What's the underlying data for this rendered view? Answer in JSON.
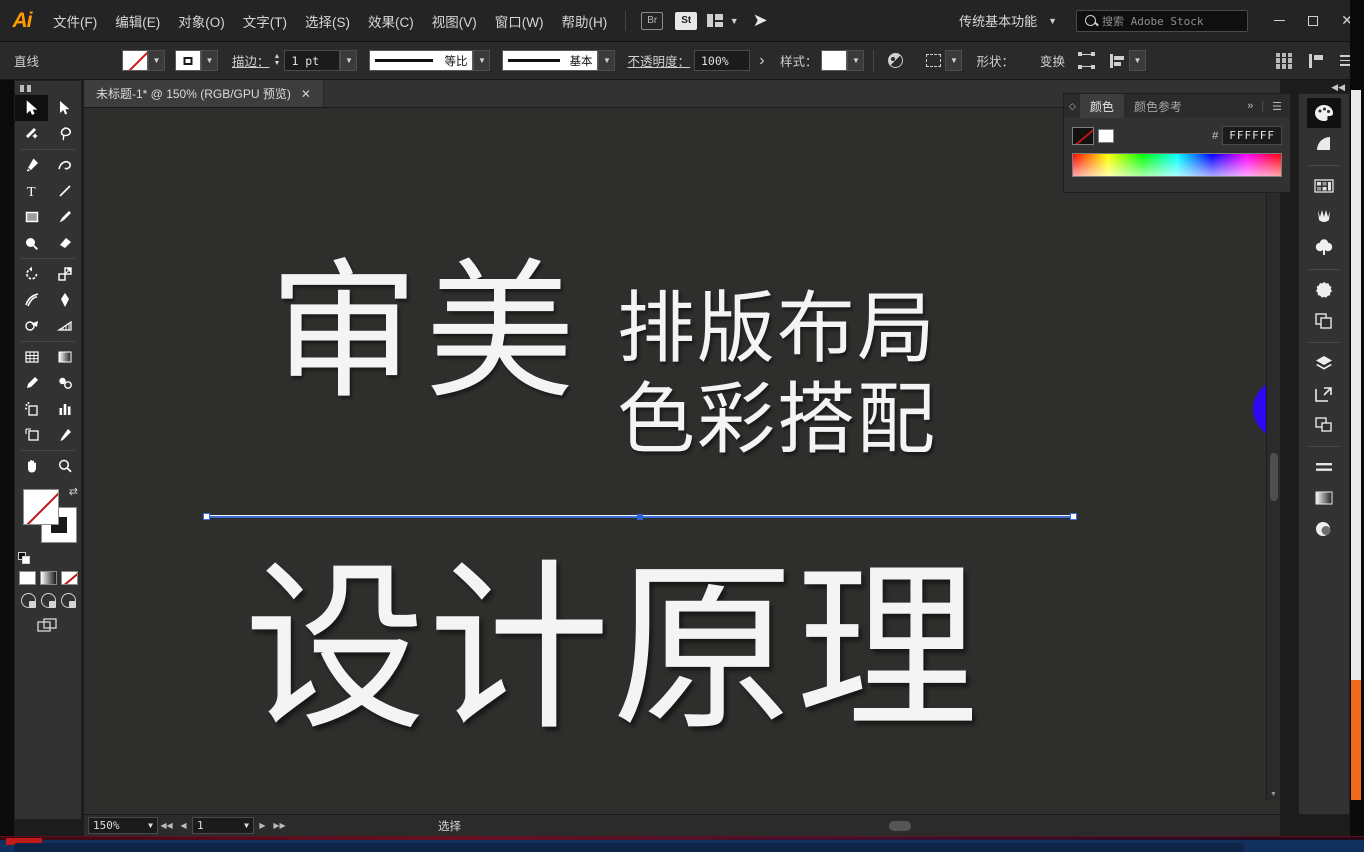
{
  "app": {
    "name": "Adobe Illustrator",
    "logo": "Ai"
  },
  "menubar": {
    "items": [
      {
        "label": "文件(F)",
        "name": "menu-file"
      },
      {
        "label": "编辑(E)",
        "name": "menu-edit"
      },
      {
        "label": "对象(O)",
        "name": "menu-object"
      },
      {
        "label": "文字(T)",
        "name": "menu-type"
      },
      {
        "label": "选择(S)",
        "name": "menu-select"
      },
      {
        "label": "效果(C)",
        "name": "menu-effect"
      },
      {
        "label": "视图(V)",
        "name": "menu-view"
      },
      {
        "label": "窗口(W)",
        "name": "menu-window"
      },
      {
        "label": "帮助(H)",
        "name": "menu-help"
      }
    ],
    "bridge_label": "Br",
    "stock_label": "St",
    "workspace": "传统基本功能",
    "search_placeholder": "搜索 Adobe Stock"
  },
  "controlbar": {
    "object_label": "直线",
    "stroke_label": "描边：",
    "stroke_weight": "1 pt",
    "profile_label": "等比",
    "brush_label": "基本",
    "opacity_label": "不透明度：",
    "opacity_value": "100%",
    "style_label": "样式：",
    "shape_label": "形状：",
    "transform_label": "变换"
  },
  "document_tab": {
    "title": "未标题-1* @ 150% (RGB/GPU 预览)",
    "close": "✕"
  },
  "toolbar": {
    "tools": [
      {
        "name": "selection-tool",
        "label": "选择工具",
        "active": true
      },
      {
        "name": "direct-selection-tool",
        "label": "直接选择工具",
        "active": false
      },
      {
        "name": "magic-wand-tool",
        "label": "魔棒工具",
        "active": false
      },
      {
        "name": "lasso-tool",
        "label": "套索工具",
        "active": false
      },
      {
        "name": "pen-tool",
        "label": "钢笔工具",
        "active": false
      },
      {
        "name": "curvature-tool",
        "label": "曲率工具",
        "active": false
      },
      {
        "name": "type-tool",
        "label": "文字工具",
        "active": false
      },
      {
        "name": "line-segment-tool",
        "label": "直线段工具",
        "active": false
      },
      {
        "name": "rectangle-tool",
        "label": "矩形工具",
        "active": false
      },
      {
        "name": "paintbrush-tool",
        "label": "画笔工具",
        "active": false
      },
      {
        "name": "shaper-tool",
        "label": "Shaper 工具",
        "active": false
      },
      {
        "name": "eraser-tool",
        "label": "橡皮擦工具",
        "active": false
      },
      {
        "name": "rotate-tool",
        "label": "旋转工具",
        "active": false
      },
      {
        "name": "scale-tool",
        "label": "比例缩放工具",
        "active": false
      },
      {
        "name": "width-tool",
        "label": "宽度工具",
        "active": false
      },
      {
        "name": "free-transform-tool",
        "label": "自由变换工具",
        "active": false
      },
      {
        "name": "shape-builder-tool",
        "label": "形状生成器工具",
        "active": false
      },
      {
        "name": "perspective-grid-tool",
        "label": "透视网格工具",
        "active": false
      },
      {
        "name": "mesh-tool",
        "label": "网格工具",
        "active": false
      },
      {
        "name": "gradient-tool",
        "label": "渐变工具",
        "active": false
      },
      {
        "name": "eyedropper-tool",
        "label": "吸管工具",
        "active": false
      },
      {
        "name": "blend-tool",
        "label": "混合工具",
        "active": false
      },
      {
        "name": "symbol-sprayer-tool",
        "label": "符号喷枪工具",
        "active": false
      },
      {
        "name": "column-graph-tool",
        "label": "柱形图工具",
        "active": false
      },
      {
        "name": "artboard-tool",
        "label": "画板工具",
        "active": false
      },
      {
        "name": "slice-tool",
        "label": "切片工具",
        "active": false
      },
      {
        "name": "hand-tool",
        "label": "抓手工具",
        "active": false
      },
      {
        "name": "zoom-tool",
        "label": "缩放工具",
        "active": false
      }
    ],
    "fill_color": "none",
    "stroke_color": "#FFFFFF",
    "color_modes": [
      "白色",
      "渐变",
      "无"
    ]
  },
  "color_panel": {
    "tabs": [
      {
        "label": "颜色",
        "active": true
      },
      {
        "label": "颜色参考",
        "active": false
      }
    ],
    "hash": "#",
    "hex_value": "FFFFFF",
    "expand": "»",
    "menu": "☰"
  },
  "dock": {
    "items": [
      {
        "name": "color-panel-icon",
        "label": "颜色",
        "active": true
      },
      {
        "name": "color-guide-icon",
        "label": "颜色参考",
        "active": false
      },
      {
        "name": "swatches-panel-icon",
        "label": "色板",
        "active": false
      },
      {
        "name": "brushes-panel-icon",
        "label": "画笔",
        "active": false
      },
      {
        "name": "symbols-panel-icon",
        "label": "符号",
        "active": false
      },
      {
        "name": "stroke-panel-icon",
        "label": "描边",
        "active": false
      },
      {
        "name": "pathfinder-panel-icon",
        "label": "路径查找器",
        "active": false
      },
      {
        "name": "layers-panel-icon",
        "label": "图层",
        "active": false
      },
      {
        "name": "transform-panel-icon",
        "label": "变换",
        "active": false
      },
      {
        "name": "align-panel-icon",
        "label": "对齐",
        "active": false
      },
      {
        "name": "appearance-panel-icon",
        "label": "外观",
        "active": false
      },
      {
        "name": "gradient-panel-icon",
        "label": "渐变",
        "active": false
      },
      {
        "name": "transparency-panel-icon",
        "label": "透明度",
        "active": false
      }
    ]
  },
  "canvas": {
    "background": "#2e2e2c",
    "artwork": {
      "headline_large": "审美",
      "sub_line_1": "排版布局",
      "sub_line_2": "色彩搭配",
      "headline_bottom": "设计原理",
      "text_color": "#F4F4F4"
    },
    "selection": {
      "type": "line",
      "stroke_color": "#FFFFFF",
      "selection_color": "#3D6BD8",
      "anchor_count": 3
    },
    "cursor_highlight_color": "#2B08F0"
  },
  "statusbar": {
    "zoom": "150%",
    "page": "1",
    "tool_status": "选择"
  }
}
